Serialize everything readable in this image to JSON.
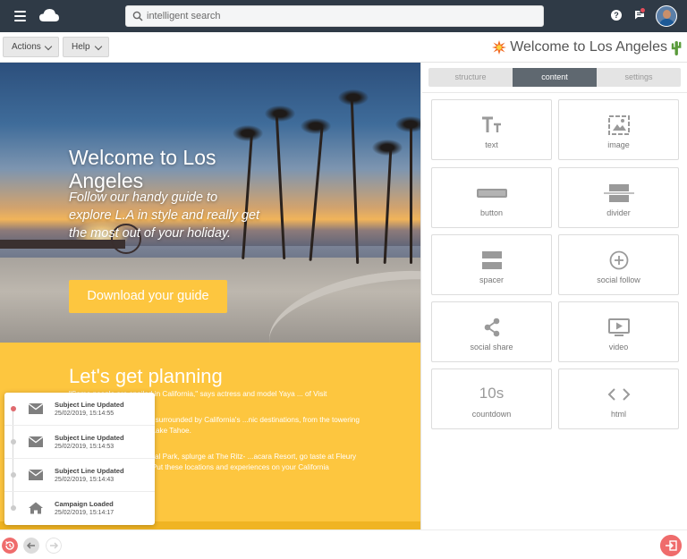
{
  "topbar": {
    "search_placeholder": "intelligent search",
    "help_glyph": "?",
    "icons": [
      "menu-icon",
      "cloud-logo-icon",
      "search-icon",
      "help-icon",
      "chat-icon",
      "avatar"
    ],
    "accent": "#2f3a46"
  },
  "toolbar": {
    "actions_label": "Actions",
    "help_label": "Help",
    "title": "Welcome to Los Angeles"
  },
  "email": {
    "hero_title": "Welcome to Los Angeles",
    "hero_subtitle": "Follow our handy guide to explore L.A in style and really get the most out of your holiday.",
    "cta_label": "Download your guide",
    "section_title": "Let's get planning",
    "paragraphs": [
      "\"Some people are spoiled in California,\" says actress and model Yaya ... of Visit California's latest advert.",
      "...feel spoiled when you're surrounded by California's ...nic destinations, from the towering Golden Gate Bridge ...ke Lake Tahoe.",
      "...nyon in Redwood National Park, splurge at The Ritz- ...acara Resort, go taste at Fleury Estate Winery in Napa ... Put these locations and experiences on your California"
    ],
    "brand_yellow": "#fdc63f"
  },
  "panel": {
    "tabs": [
      {
        "label": "structure",
        "active": false
      },
      {
        "label": "content",
        "active": true
      },
      {
        "label": "settings",
        "active": false
      }
    ],
    "blocks": [
      {
        "label": "text",
        "icon": "text-icon"
      },
      {
        "label": "image",
        "icon": "image-icon"
      },
      {
        "label": "button",
        "icon": "button-icon"
      },
      {
        "label": "divider",
        "icon": "divider-icon"
      },
      {
        "label": "spacer",
        "icon": "spacer-icon"
      },
      {
        "label": "social follow",
        "icon": "plus-circle-icon"
      },
      {
        "label": "social share",
        "icon": "share-icon"
      },
      {
        "label": "video",
        "icon": "video-icon"
      },
      {
        "label": "countdown",
        "icon": "countdown-icon",
        "glyph": "10s"
      },
      {
        "label": "html",
        "icon": "code-icon"
      }
    ]
  },
  "history": [
    {
      "title": "Subject Line Updated",
      "time": "25/02/2019, 15:14:55",
      "icon": "mail-icon",
      "active": true
    },
    {
      "title": "Subject Line Updated",
      "time": "25/02/2019, 15:14:53",
      "icon": "mail-icon",
      "active": false
    },
    {
      "title": "Subject Line Updated",
      "time": "25/02/2019, 15:14:43",
      "icon": "mail-icon",
      "active": false
    },
    {
      "title": "Campaign Loaded",
      "time": "25/02/2019, 15:14:17",
      "icon": "home-icon",
      "active": false
    }
  ],
  "bottombar": {
    "icons": [
      "history-icon",
      "undo-icon",
      "redo-icon",
      "exit-icon"
    ],
    "history_color": "#ef6c6c"
  }
}
